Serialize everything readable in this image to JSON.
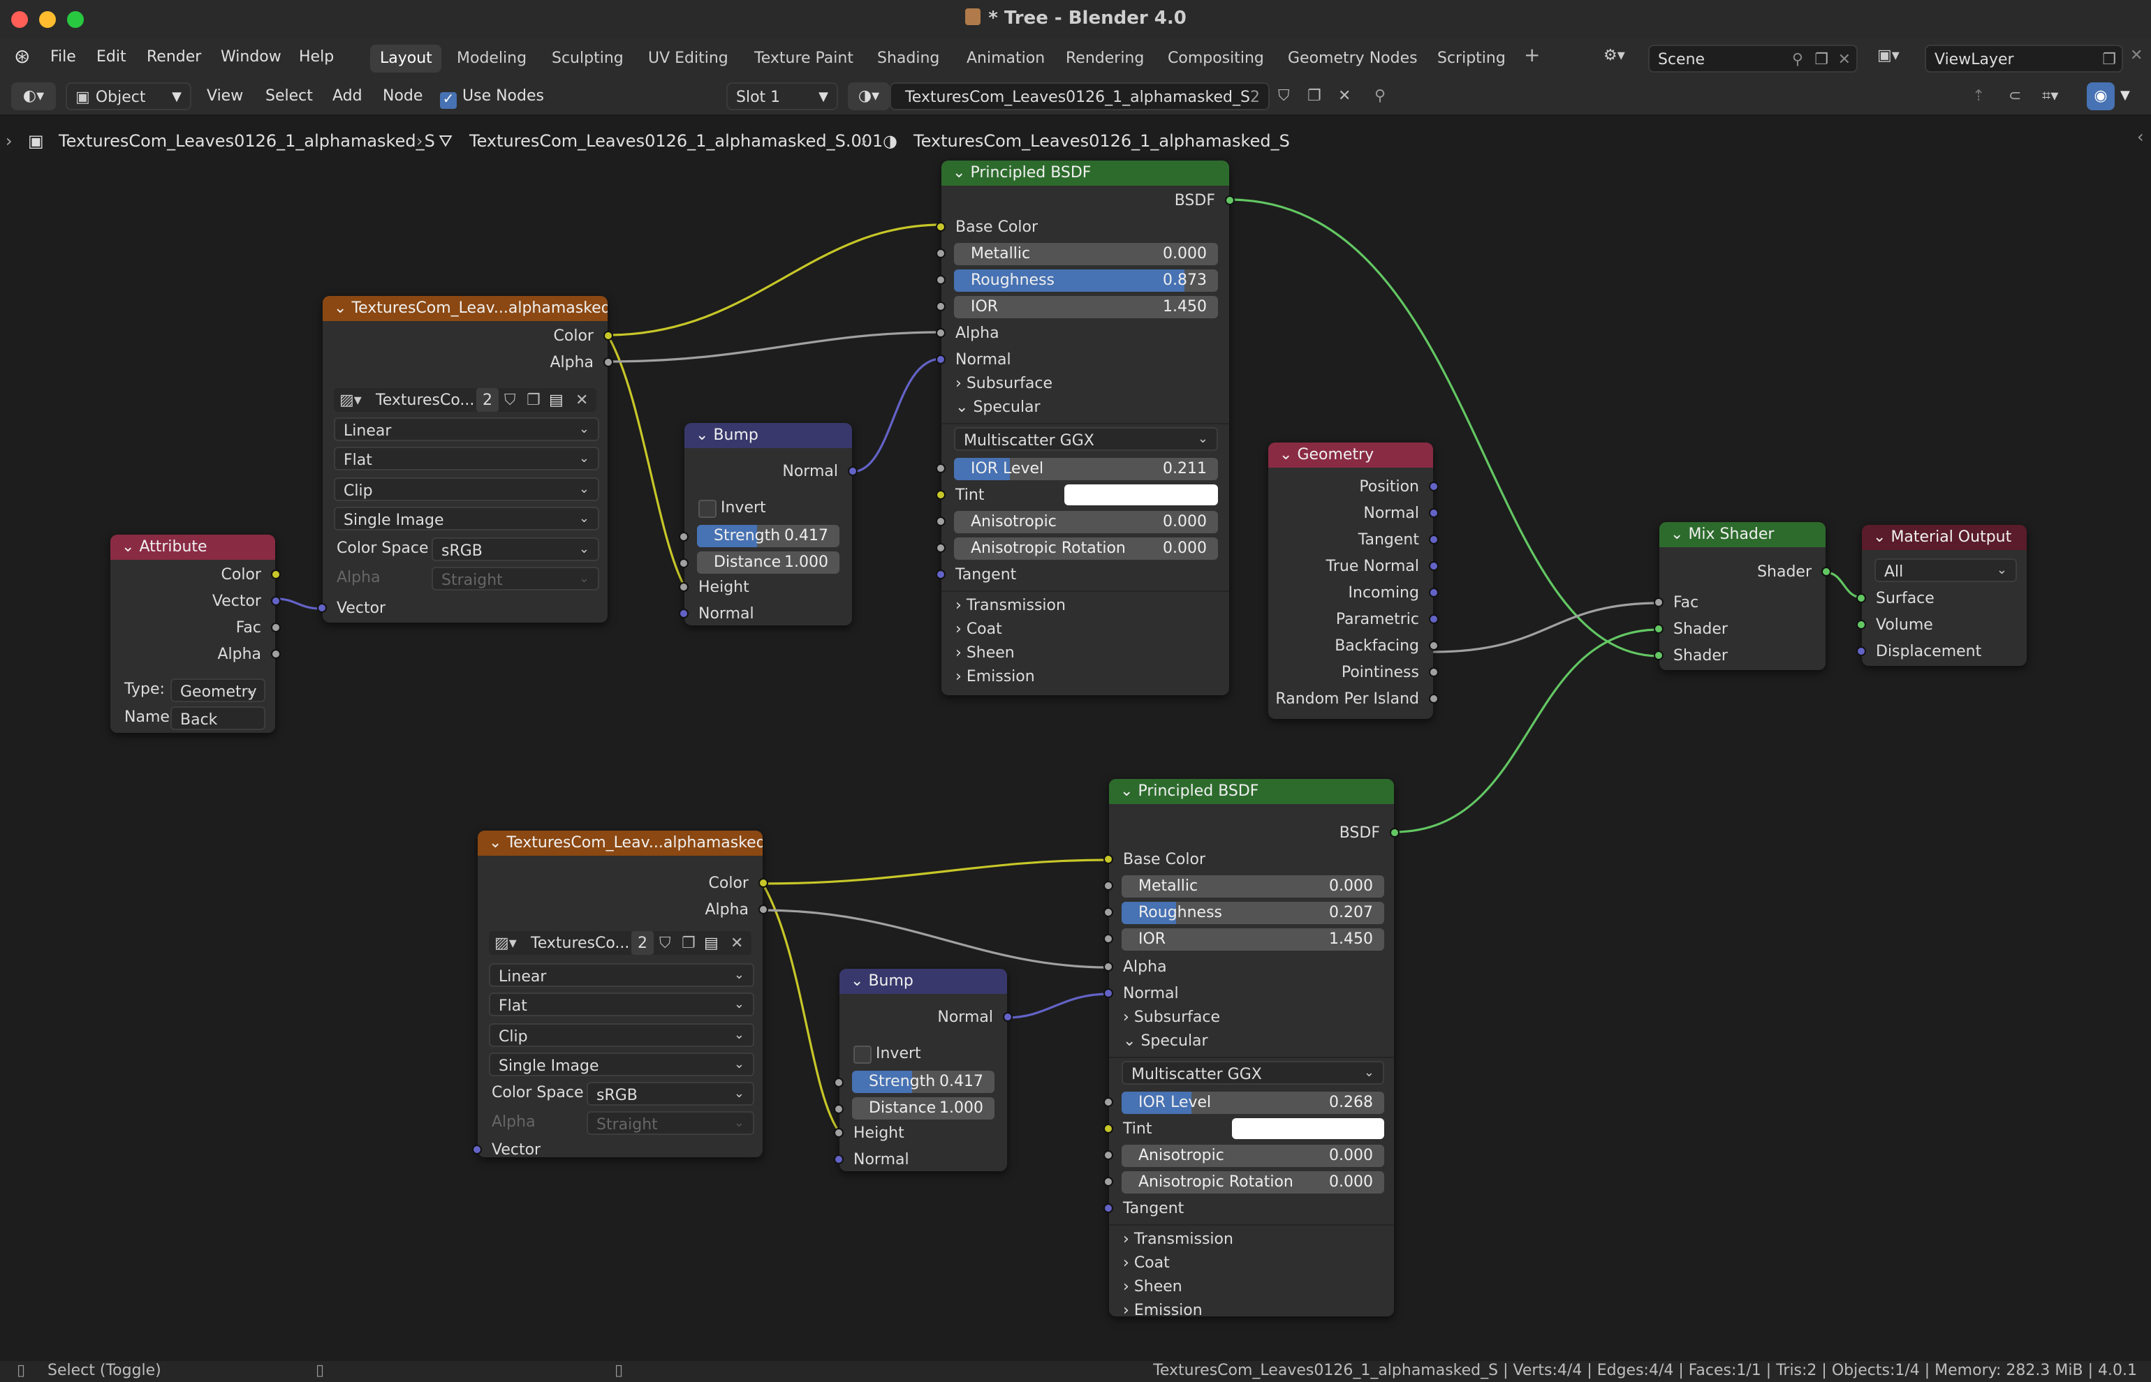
{
  "window": {
    "title": "* Tree - Blender 4.0"
  },
  "menu": {
    "items": [
      "File",
      "Edit",
      "Render",
      "Window",
      "Help"
    ]
  },
  "workspaces": [
    "Layout",
    "Modeling",
    "Sculpting",
    "UV Editing",
    "Texture Paint",
    "Shading",
    "Animation",
    "Rendering",
    "Compositing",
    "Geometry Nodes",
    "Scripting"
  ],
  "scene": {
    "scene_name": "Scene",
    "view_layer": "ViewLayer"
  },
  "toolbar": {
    "mode": "Object",
    "view": "View",
    "select": "Select",
    "add": "Add",
    "node": "Node",
    "use_nodes_label": "Use Nodes",
    "slot": "Slot 1",
    "material_name": "TexturesCom_Leaves0126_1_alphamasked_S",
    "material_users": "2"
  },
  "breadcrumb": {
    "object": "TexturesCom_Leaves0126_1_alphamasked_S",
    "mesh": "TexturesCom_Leaves0126_1_alphamasked_S.001",
    "material": "TexturesCom_Leaves0126_1_alphamasked_S"
  },
  "nodes": {
    "attribute": {
      "title": "Attribute",
      "outputs": [
        "Color",
        "Vector",
        "Fac",
        "Alpha"
      ],
      "type_label": "Type:",
      "type_value": "Geometry",
      "name_label": "Name:",
      "name_value": "Back"
    },
    "image1": {
      "title": "TexturesCom_Leav...alphamasked_S.png",
      "out_color": "Color",
      "out_alpha": "Alpha",
      "image_name": "TexturesCo...",
      "users": "2",
      "interpolation": "Linear",
      "projection": "Flat",
      "extension": "Clip",
      "source": "Single Image",
      "color_space_label": "Color Space",
      "color_space": "sRGB",
      "alpha_label": "Alpha",
      "alpha_mode": "Straight",
      "in_vector": "Vector"
    },
    "image2": {
      "title": "TexturesCom_Leav...alphamasked_S.png",
      "out_color": "Color",
      "out_alpha": "Alpha",
      "image_name": "TexturesCo...",
      "users": "2",
      "interpolation": "Linear",
      "projection": "Flat",
      "extension": "Clip",
      "source": "Single Image",
      "color_space_label": "Color Space",
      "color_space": "sRGB",
      "alpha_label": "Alpha",
      "alpha_mode": "Straight",
      "in_vector": "Vector"
    },
    "bump1": {
      "title": "Bump",
      "out_normal": "Normal",
      "invert": "Invert",
      "strength_label": "Strength",
      "strength": "0.417",
      "strength_fraction": 0.417,
      "distance_label": "Distance",
      "distance": "1.000",
      "in_height": "Height",
      "in_normal": "Normal"
    },
    "bump2": {
      "title": "Bump",
      "out_normal": "Normal",
      "invert": "Invert",
      "strength_label": "Strength",
      "strength": "0.417",
      "strength_fraction": 0.417,
      "distance_label": "Distance",
      "distance": "1.000",
      "in_height": "Height",
      "in_normal": "Normal"
    },
    "bsdf1": {
      "title": "Principled BSDF",
      "out": "BSDF",
      "base_color": "Base Color",
      "metallic_label": "Metallic",
      "metallic": "0.000",
      "metallic_fraction": 0.0,
      "roughness_label": "Roughness",
      "roughness": "0.873",
      "roughness_fraction": 0.873,
      "ior_label": "IOR",
      "ior": "1.450",
      "alpha": "Alpha",
      "normal": "Normal",
      "subsurface": "Subsurface",
      "specular": "Specular",
      "distribution": "Multiscatter GGX",
      "ior_level_label": "IOR Level",
      "ior_level": "0.211",
      "ior_level_fraction": 0.211,
      "tint": "Tint",
      "anisotropic_label": "Anisotropic",
      "anisotropic": "0.000",
      "aniso_rot_label": "Anisotropic Rotation",
      "aniso_rot": "0.000",
      "tangent": "Tangent",
      "transmission": "Transmission",
      "coat": "Coat",
      "sheen": "Sheen",
      "emission": "Emission"
    },
    "bsdf2": {
      "title": "Principled BSDF",
      "out": "BSDF",
      "base_color": "Base Color",
      "metallic_label": "Metallic",
      "metallic": "0.000",
      "metallic_fraction": 0.0,
      "roughness_label": "Roughness",
      "roughness": "0.207",
      "roughness_fraction": 0.207,
      "ior_label": "IOR",
      "ior": "1.450",
      "alpha": "Alpha",
      "normal": "Normal",
      "subsurface": "Subsurface",
      "specular": "Specular",
      "distribution": "Multiscatter GGX",
      "ior_level_label": "IOR Level",
      "ior_level": "0.268",
      "ior_level_fraction": 0.268,
      "tint": "Tint",
      "anisotropic_label": "Anisotropic",
      "anisotropic": "0.000",
      "aniso_rot_label": "Anisotropic Rotation",
      "aniso_rot": "0.000",
      "tangent": "Tangent",
      "transmission": "Transmission",
      "coat": "Coat",
      "sheen": "Sheen",
      "emission": "Emission"
    },
    "geometry": {
      "title": "Geometry",
      "outputs": [
        "Position",
        "Normal",
        "Tangent",
        "True Normal",
        "Incoming",
        "Parametric",
        "Backfacing",
        "Pointiness",
        "Random Per Island"
      ]
    },
    "mix": {
      "title": "Mix Shader",
      "out": "Shader",
      "fac": "Fac",
      "shader1": "Shader",
      "shader2": "Shader"
    },
    "output": {
      "title": "Material Output",
      "target": "All",
      "surface": "Surface",
      "volume": "Volume",
      "displacement": "Displacement"
    }
  },
  "statusbar": {
    "hint": "Select (Toggle)",
    "stats": "TexturesCom_Leaves0126_1_alphamasked_S | Verts:4/4 | Edges:4/4 | Faces:1/1 | Tris:2 | Objects:1/4 | Memory: 282.3 MiB | 4.0.1"
  },
  "colors": {
    "socket_color": "#c7c729",
    "socket_float": "#a1a1a1",
    "socket_vector": "#6363c7",
    "socket_shader": "#63c763",
    "header_shader": "#2d6b2d",
    "header_input": "#8a2b44",
    "header_vector": "#38386c",
    "header_texture": "#8b4812",
    "slider_fill": "#4772b3"
  }
}
